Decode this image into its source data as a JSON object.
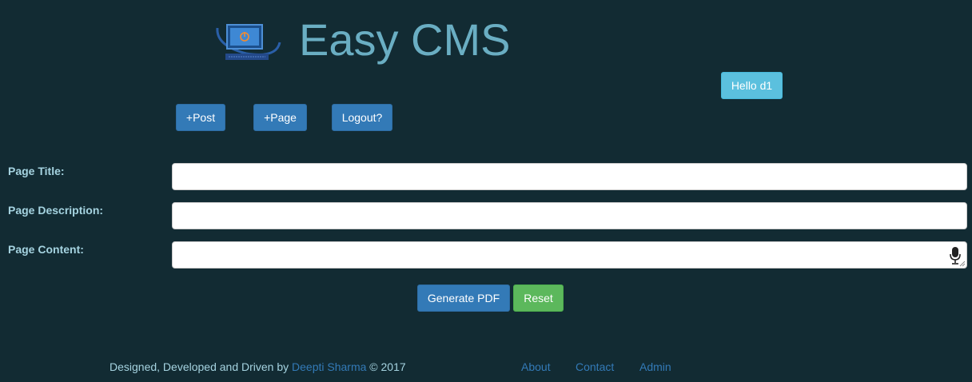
{
  "header": {
    "title": "Easy CMS",
    "logo_icon": "computer-power-icon"
  },
  "user": {
    "greeting": "Hello d1"
  },
  "toolbar": {
    "post_label": "+Post",
    "page_label": "+Page",
    "logout_label": "Logout?"
  },
  "form": {
    "title_label": "Page Title:",
    "title_value": "",
    "description_label": "Page Description:",
    "description_value": "",
    "content_label": "Page Content:",
    "content_value": "",
    "mic_icon": "microphone-icon",
    "generate_label": "Generate PDF",
    "reset_label": "Reset"
  },
  "footer": {
    "credit_prefix": "Designed, Developed and Driven by ",
    "author": "Deepti Sharma",
    "credit_suffix": " © 2017",
    "links": [
      "About",
      "Contact",
      "Admin"
    ]
  },
  "colors": {
    "background": "#122b33",
    "title": "#6aaec3",
    "primary": "#337ab7",
    "info": "#5bc0de",
    "success": "#5cb85c"
  }
}
